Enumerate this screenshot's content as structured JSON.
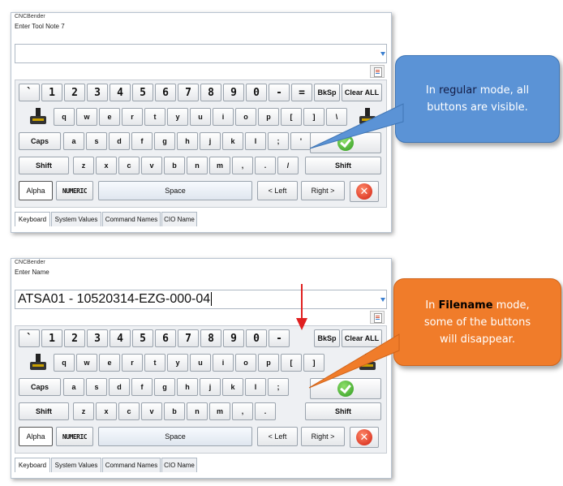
{
  "colors": {
    "blue_callout": "#5b93d6",
    "orange_callout": "#f07c2a",
    "arrow": "#e02020"
  },
  "panels": [
    {
      "title": "CNCBender",
      "prompt": "Enter Tool Note 7",
      "field_value": "",
      "rows": {
        "row1": [
          "`",
          "1",
          "2",
          "3",
          "4",
          "5",
          "6",
          "7",
          "8",
          "9",
          "0",
          "-",
          "="
        ],
        "row2": [
          "q",
          "w",
          "e",
          "r",
          "t",
          "y",
          "u",
          "i",
          "o",
          "p",
          "[",
          "]",
          "\\"
        ],
        "row3": [
          "a",
          "s",
          "d",
          "f",
          "g",
          "h",
          "j",
          "k",
          "l",
          ";",
          "'"
        ],
        "row4": [
          "z",
          "x",
          "c",
          "v",
          "b",
          "n",
          "m",
          ",",
          ".",
          "/"
        ]
      },
      "keys": {
        "bksp": "BkSp",
        "clear_all": "Clear ALL",
        "caps": "Caps",
        "shift": "Shift",
        "alpha": "Alpha",
        "numeric": "NUMERIC",
        "space": "Space",
        "left": "< Left",
        "right": "Right >"
      },
      "tabs": [
        "Keyboard",
        "System Values",
        "Command Names",
        "CIO Name"
      ]
    },
    {
      "title": "CNCBender",
      "prompt": "Enter Name",
      "field_value": "ATSA01 - 10520314-EZG-000-04",
      "rows": {
        "row1": [
          "`",
          "1",
          "2",
          "3",
          "4",
          "5",
          "6",
          "7",
          "8",
          "9",
          "0",
          "-"
        ],
        "row2": [
          "q",
          "w",
          "e",
          "r",
          "t",
          "y",
          "u",
          "i",
          "o",
          "p",
          "[",
          "]"
        ],
        "row3": [
          "a",
          "s",
          "d",
          "f",
          "g",
          "h",
          "j",
          "k",
          "l",
          ";"
        ],
        "row4": [
          "z",
          "x",
          "c",
          "v",
          "b",
          "n",
          "m",
          ",",
          "."
        ]
      },
      "keys": {
        "bksp": "BkSp",
        "clear_all": "Clear ALL",
        "caps": "Caps",
        "shift": "Shift",
        "alpha": "Alpha",
        "numeric": "NUMERIC",
        "space": "Space",
        "left": "< Left",
        "right": "Right >"
      },
      "tabs": [
        "Keyboard",
        "System Values",
        "Command Names",
        "CIO Name"
      ]
    }
  ],
  "callouts": {
    "regular": {
      "pre": "In ",
      "hl": "regular",
      "post": " mode, all",
      "line2": "buttons are visible."
    },
    "filename": {
      "pre": "In ",
      "hl": "Filename",
      "post": " mode,",
      "line2": "some of the buttons",
      "line3": "will disappear."
    }
  }
}
